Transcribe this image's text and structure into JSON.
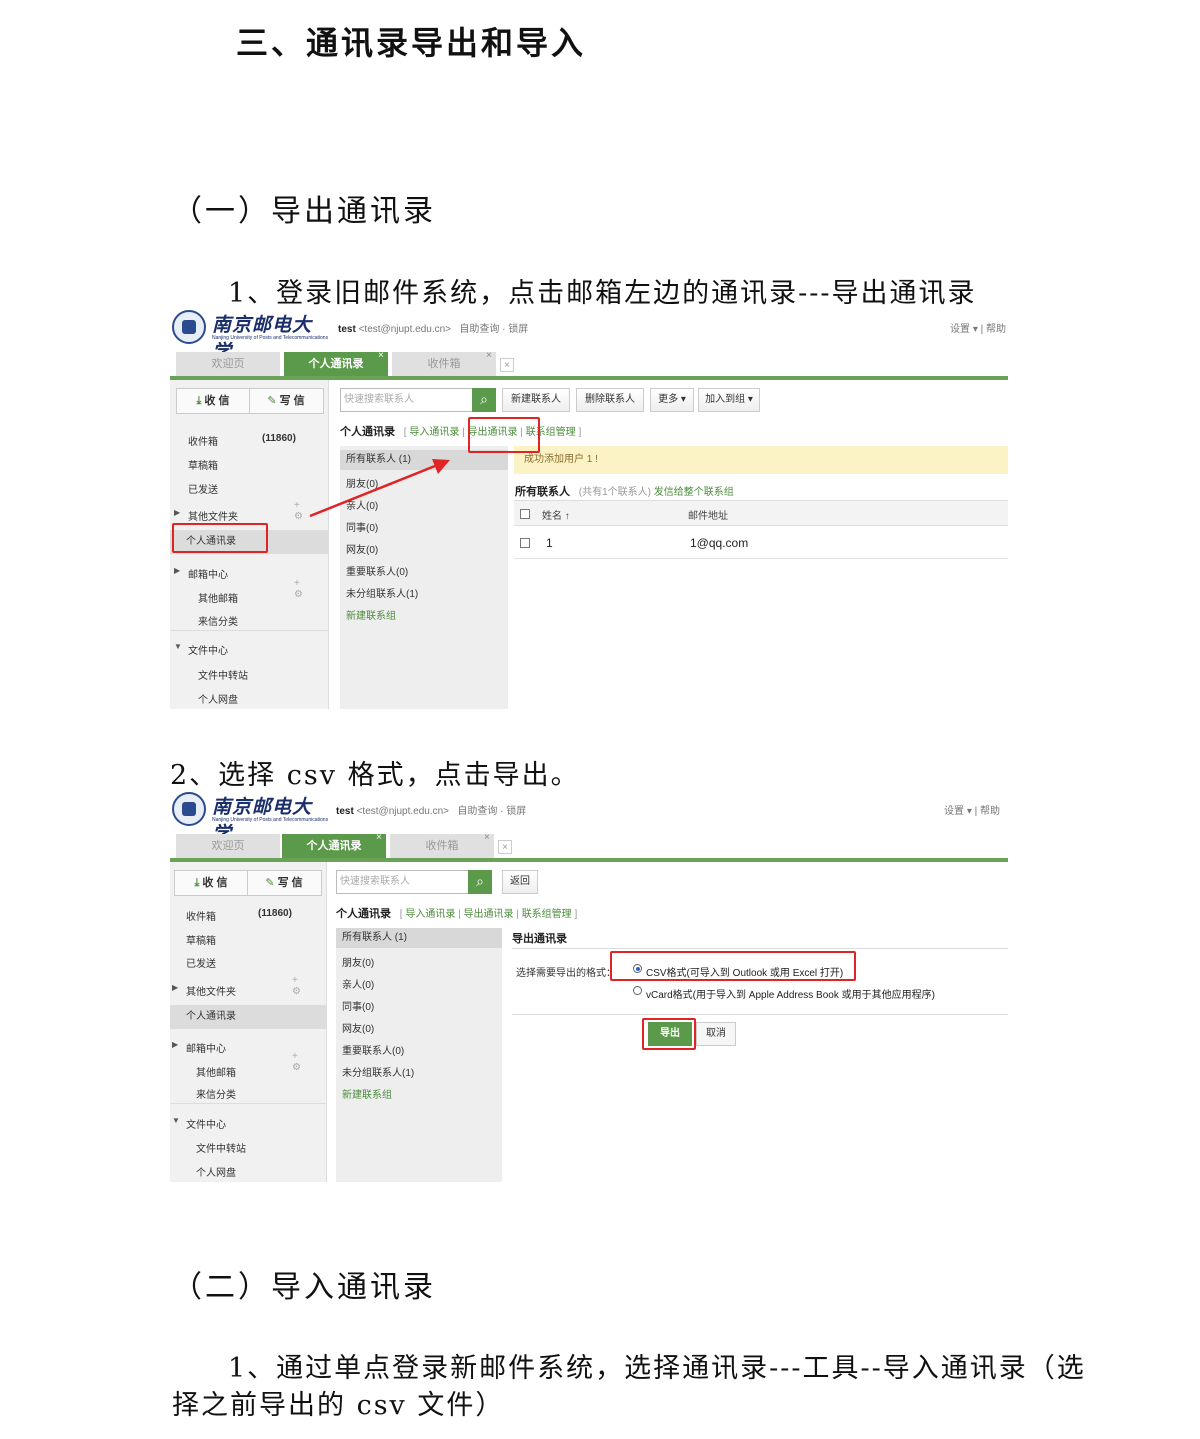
{
  "doc": {
    "section3_title": "三、通讯录导出和导入",
    "part1_heading": "（一）导出通讯录",
    "step1_text": "1、登录旧邮件系统，点击邮箱左边的通讯录---导出通讯录",
    "step2_text": "2、选择 csv 格式，点击导出。",
    "part2_heading": "（二）导入通讯录",
    "import_step1_line1": "1、通过单点登录新邮件系统，选择通讯录---工具--导入通讯录（选",
    "import_step1_line2": "择之前导出的 csv 文件）"
  },
  "mail": {
    "logo_cn": "南京邮电大学",
    "logo_en": "Nanjing University of Posts and Telecommunications",
    "user_name": "test",
    "user_email": "<test@njupt.edu.cn>",
    "user_links": "自助查询 · 锁屏",
    "top_right": "设置 ▾ | 帮助",
    "tabs": [
      "欢迎页",
      "个人通讯录",
      "收件箱"
    ],
    "tab_close": "×",
    "btn_receive": "收 信",
    "btn_write": "写 信",
    "sidebar": {
      "inbox": "收件箱",
      "inbox_count": "(11860)",
      "drafts": "草稿箱",
      "sent": "已发送",
      "other_folders": "其他文件夹",
      "contacts": "个人通讯录",
      "mail_center": "邮箱中心",
      "other_mailbox": "其他邮箱",
      "sort_incoming": "来信分类",
      "file_center": "文件中心",
      "file_transfer": "文件中转站",
      "netdisk": "个人网盘",
      "ctrl": "+ ⚙"
    },
    "search_placeholder": "快速搜索联系人",
    "toolbar1": [
      "新建联系人",
      "删除联系人",
      "更多 ▾",
      "加入到组 ▾"
    ],
    "back_btn": "返回",
    "crumbs": {
      "title": "个人通讯录",
      "open": "[",
      "import": "导入通讯录",
      "sep": "|",
      "export": "导出通讯录",
      "manage": "联系组管理",
      "close": "]"
    },
    "groups": [
      "所有联系人 (1)",
      "朋友(0)",
      "亲人(0)",
      "同事(0)",
      "网友(0)",
      "重要联系人(0)",
      "未分组联系人(1)",
      "新建联系组"
    ],
    "notice": "成功添加用户 1 !",
    "list_title": "所有联系人",
    "list_count": "(共有1个联系人)",
    "list_link": "发信给整个联系组",
    "col_name": "姓名 ↑",
    "col_email": "邮件地址",
    "contact_name": "1",
    "contact_email": "1@qq.com",
    "export_title": "导出通讯录",
    "export_label": "选择需要导出的格式：",
    "opt_csv": "CSV格式(可导入到 Outlook 或用 Excel 打开)",
    "opt_vcard": "vCard格式(用于导入到 Apple Address Book 或用于其他应用程序)",
    "btn_export": "导出",
    "btn_cancel": "取消"
  },
  "colors": {
    "accent_green": "#5b9a4a",
    "highlight_red": "#e02424",
    "notice_yellow": "#fbf3c6"
  }
}
